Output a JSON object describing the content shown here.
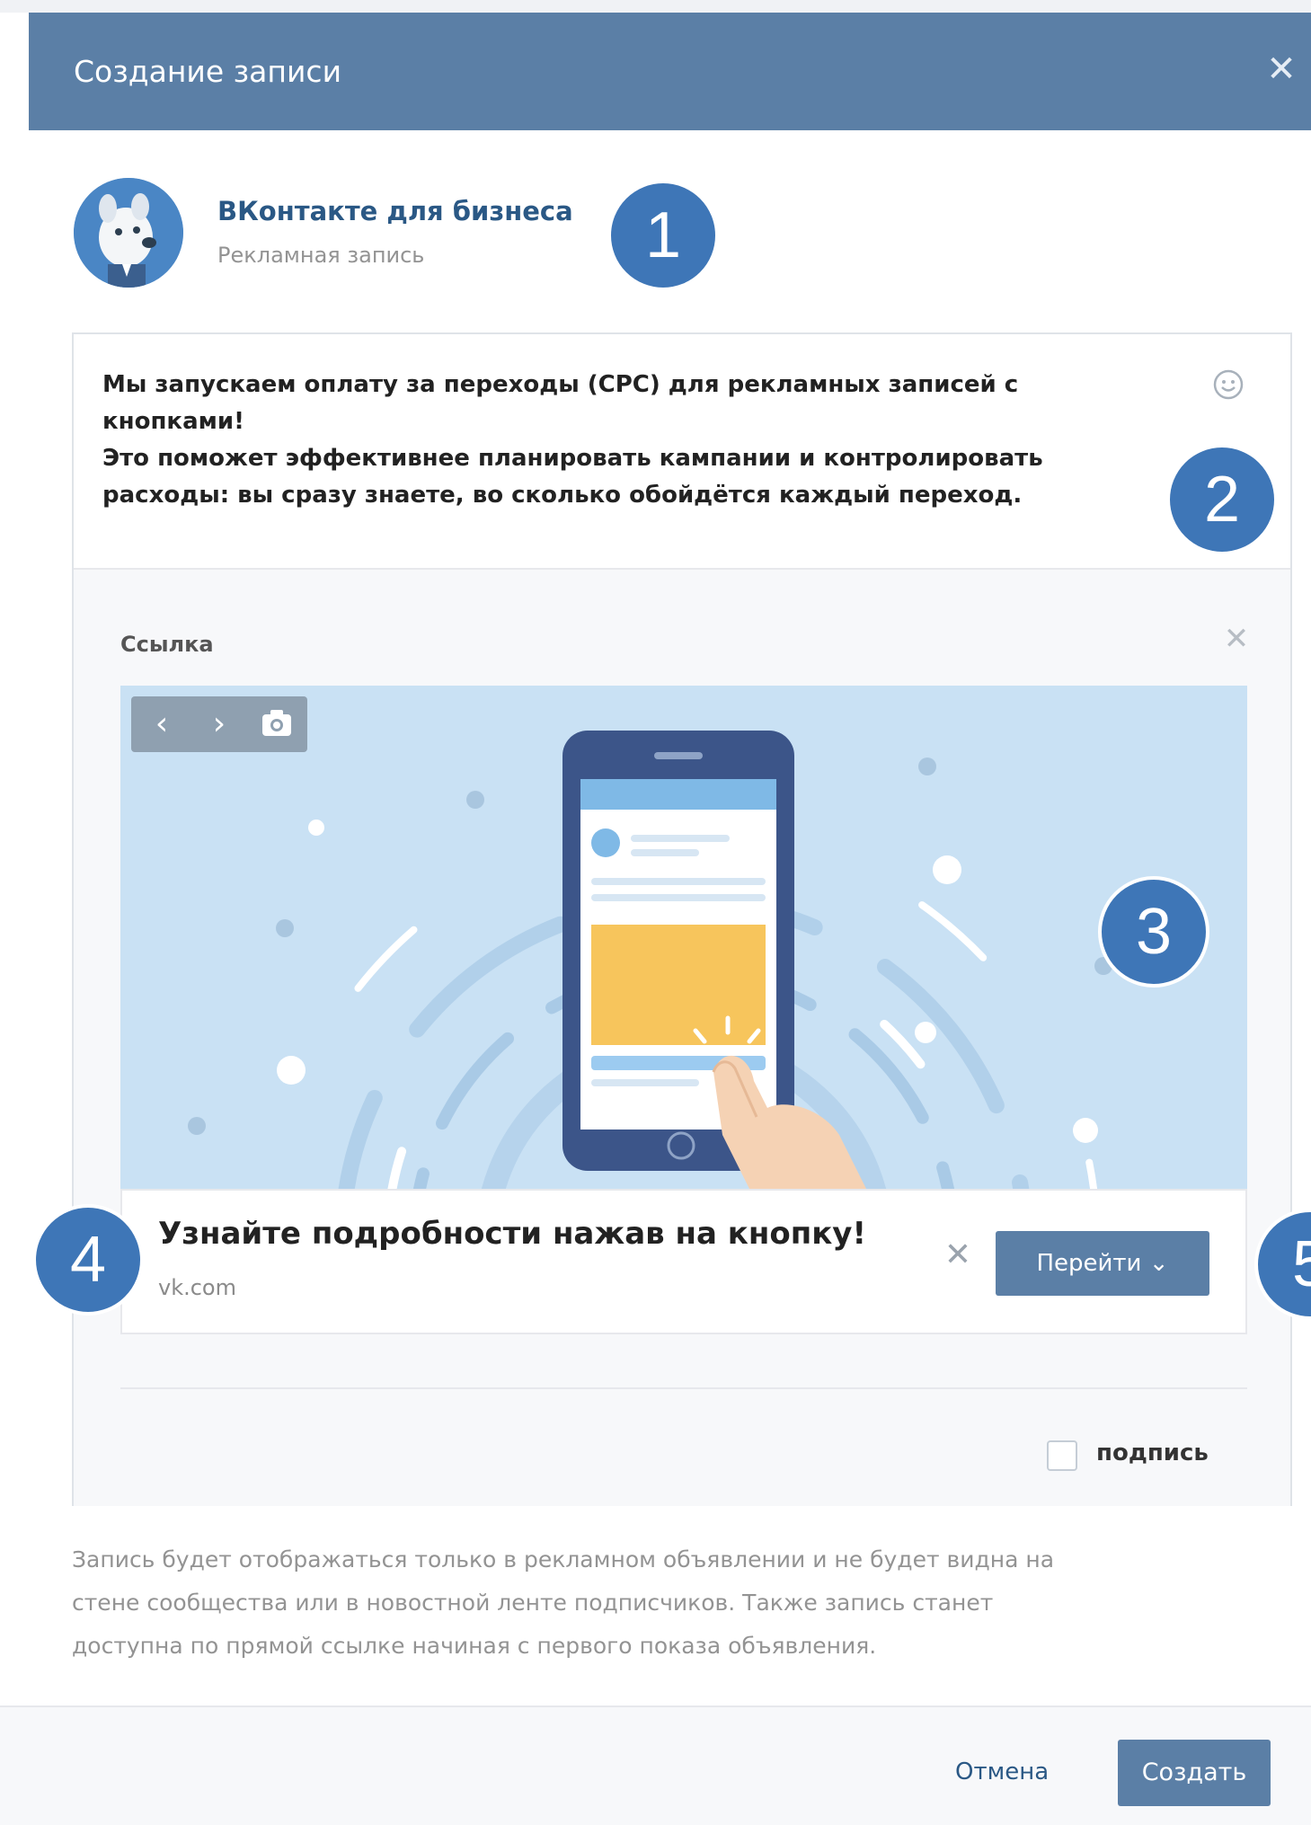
{
  "dialog": {
    "title": "Создание записи",
    "close_symbol": "✕"
  },
  "author": {
    "name": "ВКонтакте для бизнеса",
    "subtitle": "Рекламная запись"
  },
  "post": {
    "text": "Мы запускаем оплату за переходы (CPC) для рекламных записей с\nкнопками!\nЭто поможет эффективнее планировать кампании и контролировать\nрасходы: вы сразу знаете, во сколько обойдётся каждый переход.",
    "emoji_icon": "smiley-icon"
  },
  "attachment": {
    "label": "Ссылка",
    "close_symbol": "✕",
    "nav": {
      "prev": "‹",
      "next": "›",
      "camera_icon": "camera-icon"
    },
    "link_title": "Узнайте подробности нажав на кнопку!",
    "link_domain": "vk.com",
    "link_close_symbol": "✕",
    "button_label": "Перейти ⌄"
  },
  "signature": {
    "label": "подпись",
    "checked": false
  },
  "note": "Запись будет отображаться только в рекламном объявлении и не будет видна на\nстене сообщества или в новостной ленте подписчиков. Также запись станет\nдоступна по прямой ссылке начиная с первого показа объявления.",
  "footer": {
    "cancel_label": "Отмена",
    "create_label": "Создать"
  },
  "markers": [
    "1",
    "2",
    "3",
    "4",
    "5"
  ],
  "colors": {
    "header": "#5b7fa6",
    "marker": "#3e76b7",
    "link": "#2a5885"
  }
}
